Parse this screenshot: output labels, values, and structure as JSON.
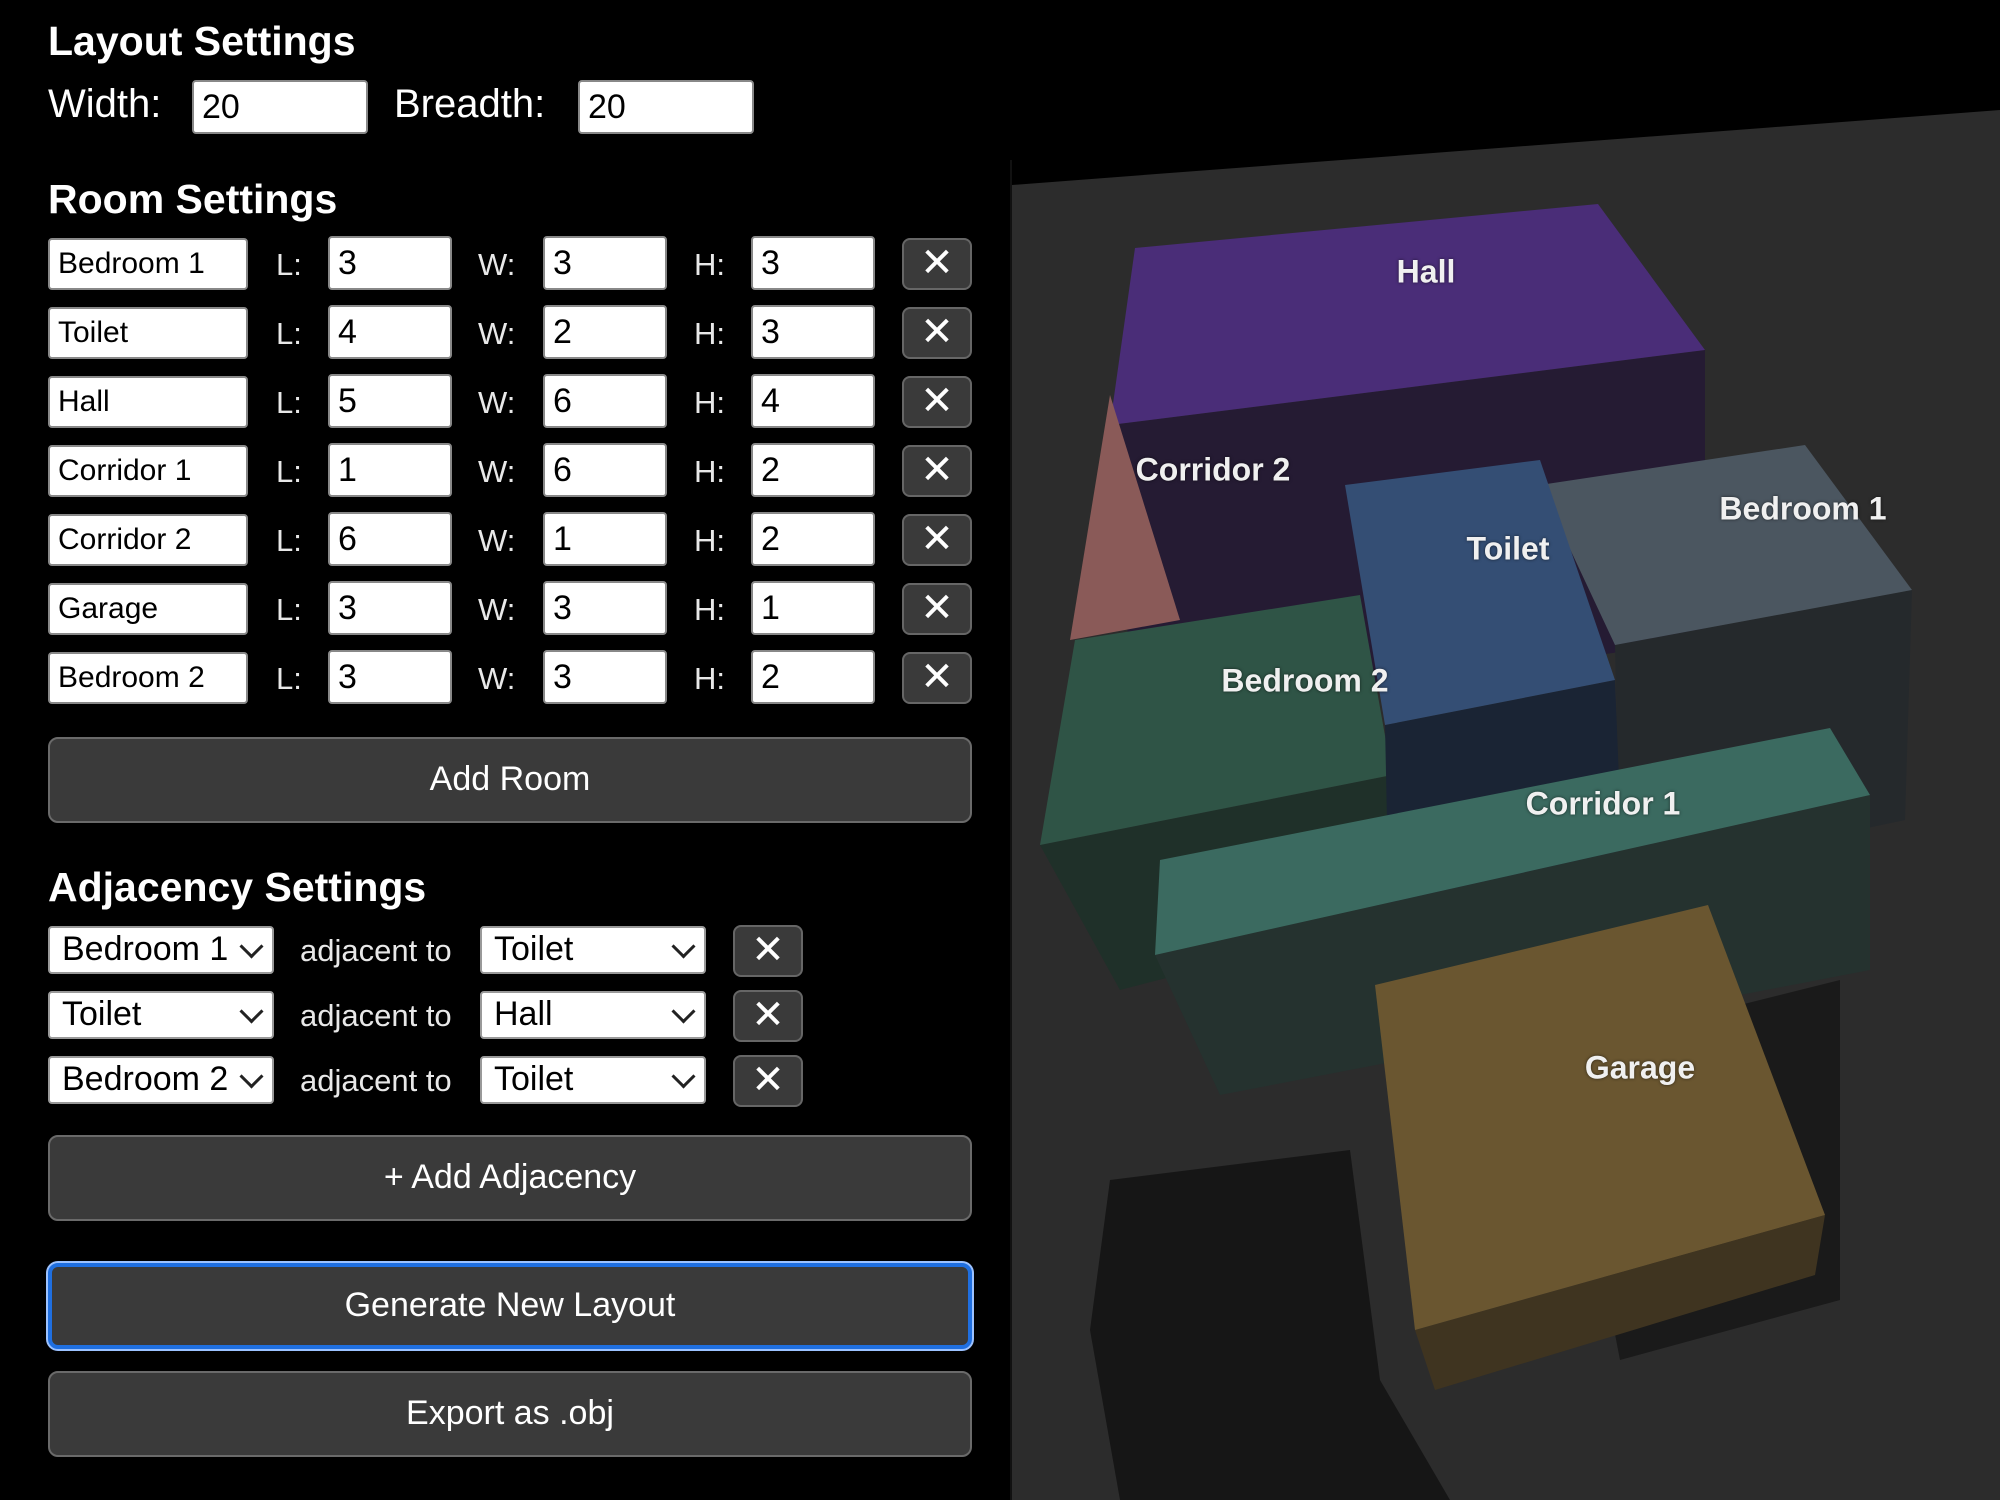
{
  "layout_settings": {
    "title": "Layout Settings",
    "width_label": "Width:",
    "width_value": "20",
    "breadth_label": "Breadth:",
    "breadth_value": "20"
  },
  "room_settings": {
    "title": "Room Settings",
    "length_label": "L:",
    "width_label": "W:",
    "height_label": "H:",
    "remove_symbol": "✕",
    "rooms": [
      {
        "name": "Bedroom 1",
        "l": "3",
        "w": "3",
        "h": "3"
      },
      {
        "name": "Toilet",
        "l": "4",
        "w": "2",
        "h": "3"
      },
      {
        "name": "Hall",
        "l": "5",
        "w": "6",
        "h": "4"
      },
      {
        "name": "Corridor 1",
        "l": "1",
        "w": "6",
        "h": "2"
      },
      {
        "name": "Corridor 2",
        "l": "6",
        "w": "1",
        "h": "2"
      },
      {
        "name": "Garage",
        "l": "3",
        "w": "3",
        "h": "1"
      },
      {
        "name": "Bedroom 2",
        "l": "3",
        "w": "3",
        "h": "2"
      }
    ],
    "add_room_label": "Add Room"
  },
  "adjacency_settings": {
    "title": "Adjacency Settings",
    "relation_text": "adjacent to",
    "remove_symbol": "✕",
    "pairs": [
      {
        "from": "Bedroom 1",
        "to": "Toilet"
      },
      {
        "from": "Toilet",
        "to": "Hall"
      },
      {
        "from": "Bedroom 2",
        "to": "Toilet"
      }
    ],
    "add_adjacency_label": "+ Add Adjacency"
  },
  "actions": {
    "generate_label": "Generate New Layout",
    "export_label": "Export as .obj"
  },
  "scene": {
    "labels": {
      "hall": "Hall",
      "corridor2": "Corridor 2",
      "bedroom1": "Bedroom 1",
      "toilet": "Toilet",
      "bedroom2": "Bedroom 2",
      "corridor1": "Corridor 1",
      "garage": "Garage"
    },
    "colors": {
      "hall": "#4a2d78",
      "corridor2": "#8a5a58",
      "bedroom1": "#4b5660",
      "toilet": "#344e74",
      "bedroom2": "#2f5446",
      "corridor1": "#3b6a60",
      "garage": "#6a5630"
    }
  }
}
